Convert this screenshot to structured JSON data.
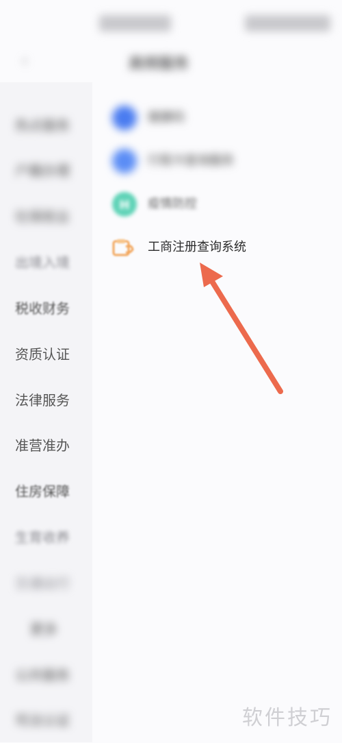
{
  "header": {
    "back_icon": "‹",
    "title": "高频服务"
  },
  "sidebar": {
    "items": [
      {
        "label": "热点服务"
      },
      {
        "label": "户籍办理"
      },
      {
        "label": "社保就业"
      },
      {
        "label": "出境入境"
      },
      {
        "label": "税收财务"
      },
      {
        "label": "资质认证"
      },
      {
        "label": "法律服务"
      },
      {
        "label": "准营准办"
      },
      {
        "label": "住房保障"
      },
      {
        "label": "生育收养"
      },
      {
        "label": "交通出行"
      },
      {
        "label": "更多"
      },
      {
        "label": "公共服务"
      },
      {
        "label": "司法公证"
      }
    ]
  },
  "services": [
    {
      "label": "健康码",
      "icon": "health-code-icon",
      "color": "#4a7cf0"
    },
    {
      "label": "行程卡查询服务",
      "icon": "trip-card-icon",
      "color": "#5b8df5"
    },
    {
      "label": "疫情防控",
      "icon": "hospital-icon",
      "color": "#5fd3b7"
    },
    {
      "label": "工商注册查询系统",
      "icon": "business-registry-icon",
      "color": "#f2a55a"
    }
  ],
  "annotation": {
    "arrow_color": "#ec6a4d"
  },
  "watermark": {
    "text": "软件技巧"
  }
}
